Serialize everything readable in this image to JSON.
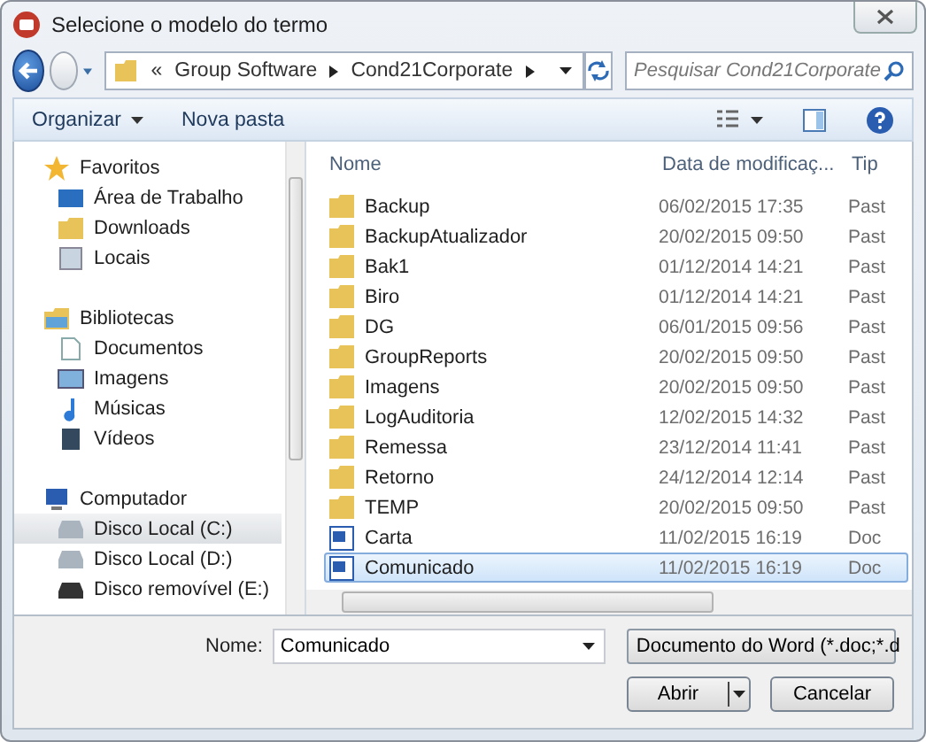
{
  "window": {
    "title": "Selecione o modelo do termo"
  },
  "address": {
    "segments": [
      "«",
      "Group Software",
      "Cond21Corporate"
    ]
  },
  "search": {
    "placeholder": "Pesquisar Cond21Corporate"
  },
  "toolbar": {
    "buttons": [
      {
        "label": "Organizar",
        "dropdown": true
      },
      {
        "label": "Nova pasta",
        "dropdown": false
      }
    ]
  },
  "sidebar": {
    "groups": [
      {
        "label": "Favoritos",
        "kind": "star",
        "children": [
          {
            "label": "Área de Trabalho",
            "kind": "desktop",
            "selected": false
          },
          {
            "label": "Downloads",
            "kind": "download",
            "selected": false
          },
          {
            "label": "Locais",
            "kind": "places",
            "selected": false
          }
        ]
      },
      {
        "label": "Bibliotecas",
        "kind": "library",
        "children": [
          {
            "label": "Documentos",
            "kind": "doc",
            "selected": false
          },
          {
            "label": "Imagens",
            "kind": "image",
            "selected": false
          },
          {
            "label": "Músicas",
            "kind": "music",
            "selected": false
          },
          {
            "label": "Vídeos",
            "kind": "video",
            "selected": false
          }
        ]
      },
      {
        "label": "Computador",
        "kind": "computer",
        "children": [
          {
            "label": "Disco Local (C:)",
            "kind": "drive",
            "selected": true
          },
          {
            "label": "Disco Local (D:)",
            "kind": "drive",
            "selected": false
          },
          {
            "label": "Disco removível (E:)",
            "kind": "removable",
            "selected": false
          }
        ]
      }
    ]
  },
  "table": {
    "columns": [
      "Nome",
      "Data de modificaç...",
      "Tip"
    ],
    "rows": [
      {
        "name": "Backup",
        "date": "06/02/2015 17:35",
        "type": "Past",
        "kind": "folder",
        "selected": false
      },
      {
        "name": "BackupAtualizador",
        "date": "20/02/2015 09:50",
        "type": "Past",
        "kind": "folder",
        "selected": false
      },
      {
        "name": "Bak1",
        "date": "01/12/2014 14:21",
        "type": "Past",
        "kind": "folder",
        "selected": false
      },
      {
        "name": "Biro",
        "date": "01/12/2014 14:21",
        "type": "Past",
        "kind": "folder",
        "selected": false
      },
      {
        "name": "DG",
        "date": "06/01/2015 09:56",
        "type": "Past",
        "kind": "folder",
        "selected": false
      },
      {
        "name": "GroupReports",
        "date": "20/02/2015 09:50",
        "type": "Past",
        "kind": "folder",
        "selected": false
      },
      {
        "name": "Imagens",
        "date": "20/02/2015 09:50",
        "type": "Past",
        "kind": "folder",
        "selected": false
      },
      {
        "name": "LogAuditoria",
        "date": "12/02/2015 14:32",
        "type": "Past",
        "kind": "folder",
        "selected": false
      },
      {
        "name": "Remessa",
        "date": "23/12/2014 11:41",
        "type": "Past",
        "kind": "folder",
        "selected": false
      },
      {
        "name": "Retorno",
        "date": "24/12/2014 12:14",
        "type": "Past",
        "kind": "folder",
        "selected": false
      },
      {
        "name": "TEMP",
        "date": "20/02/2015 09:50",
        "type": "Past",
        "kind": "folder",
        "selected": false
      },
      {
        "name": "Carta",
        "date": "11/02/2015 16:19",
        "type": "Doc",
        "kind": "word",
        "selected": false
      },
      {
        "name": "Comunicado",
        "date": "11/02/2015 16:19",
        "type": "Doc",
        "kind": "word",
        "selected": true
      }
    ]
  },
  "footer": {
    "name_label": "Nome:",
    "name_value": "Comunicado",
    "filter": "Documento do Word (*.doc;*.d",
    "buttons": [
      "Abrir",
      "Cancelar"
    ]
  }
}
